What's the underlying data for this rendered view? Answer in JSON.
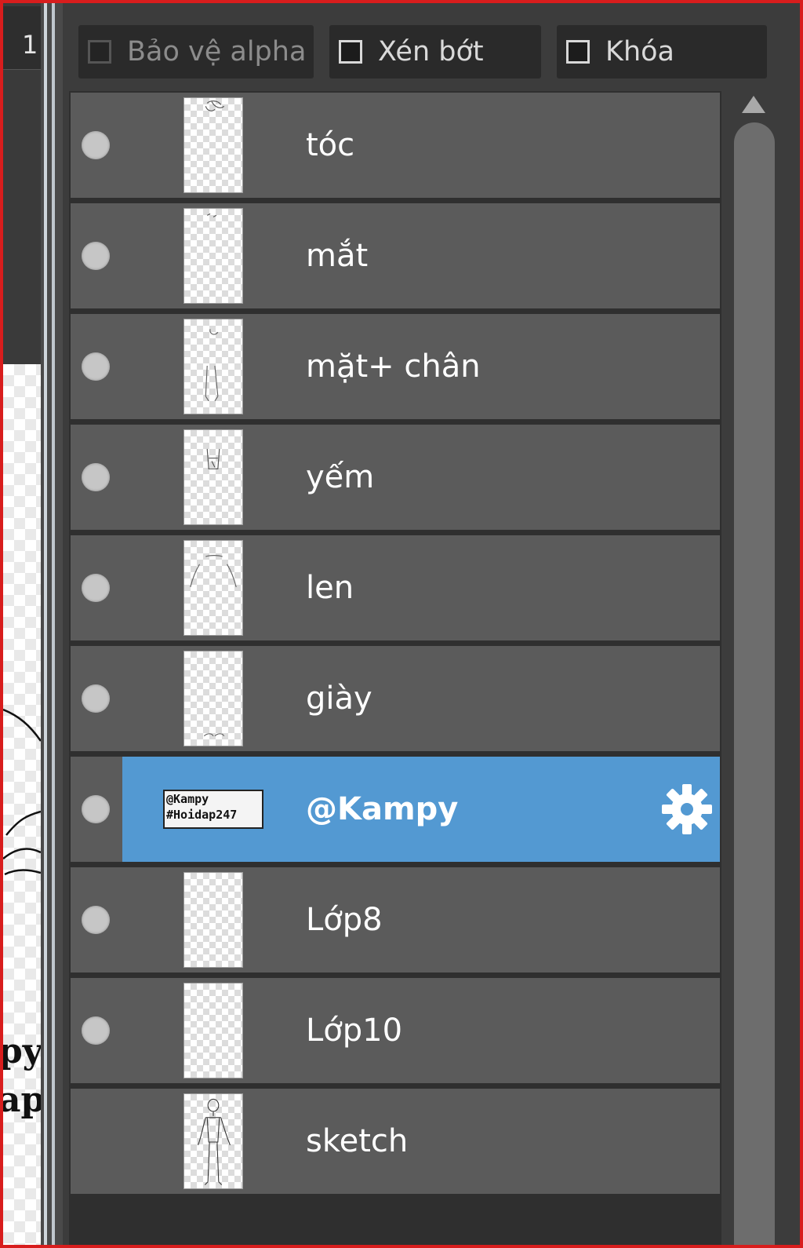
{
  "canvas": {
    "tab_label": "1",
    "text_line_1": "py",
    "text_line_2": "ap"
  },
  "toolbar": {
    "protect_alpha": {
      "label": "Bảo vệ alpha",
      "checked": false,
      "enabled": false
    },
    "clipping": {
      "label": "Xén bớt",
      "checked": false,
      "enabled": true
    },
    "lock": {
      "label": "Khóa",
      "checked": false,
      "enabled": true
    }
  },
  "layers": [
    {
      "name": "tóc",
      "visible": true,
      "selected": false,
      "thumb": "hair-sketch"
    },
    {
      "name": "mắt",
      "visible": true,
      "selected": false,
      "thumb": "eyes-sketch"
    },
    {
      "name": "mặt+ chân",
      "visible": true,
      "selected": false,
      "thumb": "face-legs-sketch"
    },
    {
      "name": "yếm",
      "visible": true,
      "selected": false,
      "thumb": "bib-sketch"
    },
    {
      "name": "len",
      "visible": true,
      "selected": false,
      "thumb": "wool-sketch"
    },
    {
      "name": "giày",
      "visible": true,
      "selected": false,
      "thumb": "shoes-sketch"
    },
    {
      "name": "@Kampy",
      "visible": true,
      "selected": true,
      "thumb": "text-watermark",
      "thumb_text_1": "@Kampy",
      "thumb_text_2": "#Hoidap247",
      "action_icon": "gear-icon"
    },
    {
      "name": "Lớp8",
      "visible": true,
      "selected": false,
      "thumb": "empty"
    },
    {
      "name": "Lớp10",
      "visible": true,
      "selected": false,
      "thumb": "empty"
    },
    {
      "name": "sketch",
      "visible": false,
      "selected": false,
      "thumb": "figure-sketch"
    }
  ],
  "colors": {
    "selected_row": "#5399d2",
    "row_bg": "#5b5b5b",
    "panel_bg": "#3c3c3c",
    "frame": "#d81d1d"
  }
}
